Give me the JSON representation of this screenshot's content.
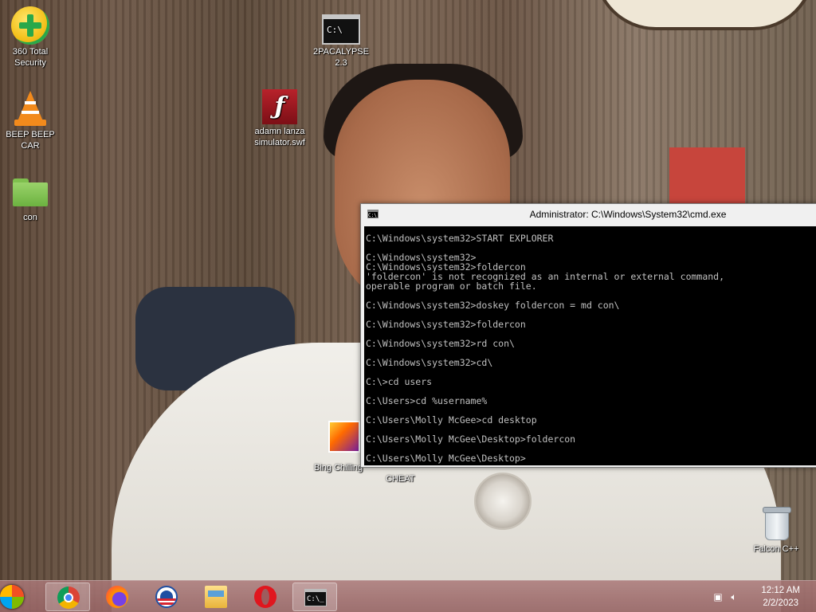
{
  "desktop_icons": {
    "security": {
      "label_line1": "360 Total",
      "label_line2": "Security",
      "icon": "shield-plus-icon"
    },
    "beep": {
      "label_line1": "BEEP BEEP",
      "label_line2": "CAR",
      "icon": "vlc-cone-icon"
    },
    "con": {
      "label": "con",
      "icon": "folder-icon"
    },
    "pacalypse": {
      "label_line1": "2PACALYPSE",
      "label_line2": "2.3",
      "icon": "cmd-icon"
    },
    "adamn": {
      "label_line1": "adamn lanza",
      "label_line2": "simulator.swf",
      "icon": "flash-icon"
    },
    "bing": {
      "label": "Bing Chilling",
      "label_tail": "CHEAT",
      "icon": "game-icon"
    },
    "falcon": {
      "label": "Falcon C++",
      "icon": "recycle-bin-icon"
    }
  },
  "cmd": {
    "title": "Administrator: C:\\Windows\\System32\\cmd.exe",
    "icon_text": "C:\\",
    "lines": [
      "C:\\Windows\\system32>START EXPLORER",
      "",
      "C:\\Windows\\system32>",
      "C:\\Windows\\system32>foldercon",
      "'foldercon' is not recognized as an internal or external command,",
      "operable program or batch file.",
      "",
      "C:\\Windows\\system32>doskey foldercon = md con\\",
      "",
      "C:\\Windows\\system32>foldercon",
      "",
      "C:\\Windows\\system32>rd con\\",
      "",
      "C:\\Windows\\system32>cd\\",
      "",
      "C:\\>cd users",
      "",
      "C:\\Users>cd %username%",
      "",
      "C:\\Users\\Molly McGee>cd desktop",
      "",
      "C:\\Users\\Molly McGee\\Desktop>foldercon",
      "",
      "C:\\Users\\Molly McGee\\Desktop>"
    ]
  },
  "taskbar": {
    "cmd_icon_text": "C:\\_",
    "apps": [
      "start-icon",
      "chrome-icon",
      "firefox-icon",
      "obama-icon",
      "file-explorer-icon",
      "opera-icon",
      "cmd-icon"
    ]
  },
  "tray": {
    "time": "12:12 AM",
    "date": "2/2/2023"
  }
}
